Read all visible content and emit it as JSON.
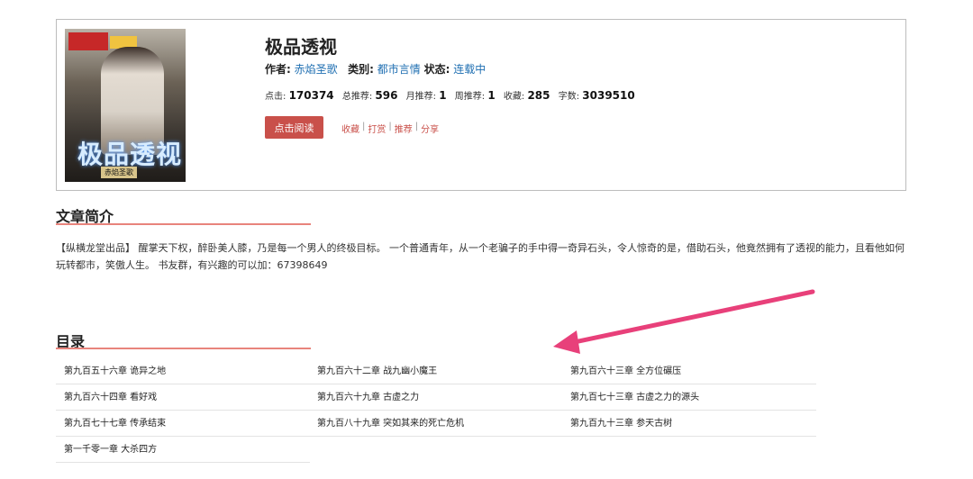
{
  "book": {
    "cover": {
      "badge_colors": [
        "#c62828",
        "#f0c340"
      ],
      "title_text": "极品透视",
      "author_text": "赤焰圣歌"
    },
    "title": "极品透视",
    "author_label": "作者:",
    "author": "赤焰圣歌",
    "category_label": "类别:",
    "category": "都市言情",
    "status_label": "状态:",
    "status": "连载中",
    "stats": {
      "clicks_label": "点击:",
      "clicks": "170374",
      "total_rec_label": "总推荐:",
      "total_rec": "596",
      "month_rec_label": "月推荐:",
      "month_rec": "1",
      "week_rec_label": "周推荐:",
      "week_rec": "1",
      "favorites_label": "收藏:",
      "favorites": "285",
      "words_label": "字数:",
      "words": "3039510"
    },
    "read_button": "点击阅读",
    "actions": [
      "收藏",
      "打赏",
      "推荐",
      "分享"
    ]
  },
  "intro": {
    "heading": "文章简介",
    "text": "【纵横龙堂出品】 醒掌天下权，醉卧美人膝，乃是每一个男人的终极目标。 一个普通青年，从一个老骗子的手中得一奇异石头，令人惊奇的是，借助石头，他竟然拥有了透视的能力，且看他如何玩转都市，笑傲人生。 书友群，有兴趣的可以加：67398649"
  },
  "toc": {
    "heading": "目录",
    "chapters": [
      "第九百五十六章 诡异之地",
      "第九百六十二章 战九幽小魔王",
      "第九百六十三章 全方位碾压",
      "第九百六十四章 看好戏",
      "第九百六十九章 古虚之力",
      "第九百七十三章 古虚之力的源头",
      "第九百七十七章 传承结束",
      "第九百八十九章 突如其来的死亡危机",
      "第九百九十三章 参天古树",
      "第一千零一章 大杀四方"
    ]
  },
  "colors": {
    "accent": "#c9504a",
    "link": "#1f6fb2",
    "arrow": "#e8407a"
  }
}
